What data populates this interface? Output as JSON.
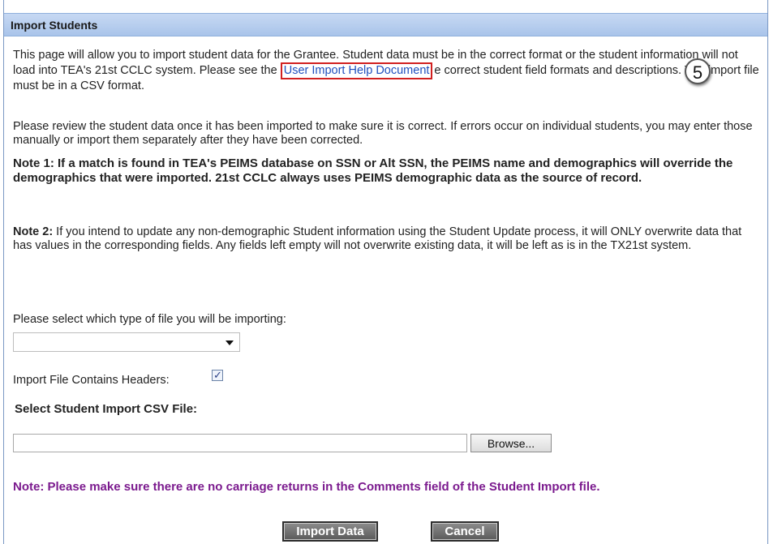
{
  "header": {
    "title": "Import Students"
  },
  "intro": {
    "p1_before_link": "This page will allow you to import student data for the Grantee. Student data must be in the correct format or the student information will not load into TEA's 21st CCLC system. Please see the ",
    "link_text": "User Import Help Document",
    "callout_number": "5",
    "p1_after_link": "e correct student field formats and descriptions. The import file must be in a CSV format.",
    "p2": "Please review the student data once it has been imported to make sure it is correct. If errors occur on individual students, you may enter those manually or import them separately after they have been corrected.",
    "note1": "Note 1: If a match is found in TEA's PEIMS database on SSN or Alt SSN, the PEIMS name and demographics will override the demographics that were imported. 21st CCLC always uses PEIMS demographic data as the source of record.",
    "note2_label": "Note 2:",
    "note2_text": " If you intend to update any non-demographic Student information using the Student Update process, it will ONLY overwrite data that has values in the corresponding fields. Any fields left empty will not overwrite existing data, it will be left as is in the TX21st system."
  },
  "form": {
    "file_type_label": "Please select which type of file you will be importing:",
    "file_type_value": "",
    "headers_label": "Import File Contains Headers:",
    "headers_checked": "✓",
    "csv_label": "Select Student Import CSV File:",
    "csv_value": "",
    "browse_label": "Browse..."
  },
  "footer_note": "Note: Please make sure there are no carriage returns in the Comments field of the Student Import file.",
  "buttons": {
    "import": "Import Data",
    "cancel": "Cancel"
  },
  "colors": {
    "header_bg": "#b9cfee",
    "link": "#1f4fbd",
    "callout_border": "#d12020",
    "note_purple": "#7b1a8e",
    "button_dark": "#6e6e6e"
  }
}
